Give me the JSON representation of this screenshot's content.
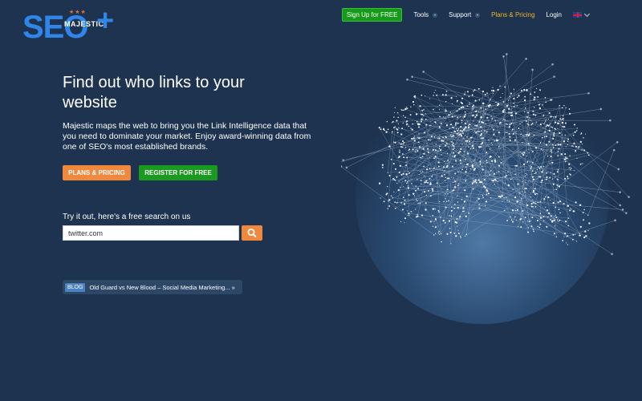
{
  "logo": {
    "text": "SEO",
    "plus": "+",
    "brand": "MAJESTIC"
  },
  "nav": {
    "signup_label": "Sign Up for FREE",
    "items": [
      {
        "label": "Tools"
      },
      {
        "label": "Support"
      }
    ],
    "plans_label": "Plans & Pricing",
    "login_label": "Login"
  },
  "hero": {
    "headline": "Find out who links to your website",
    "description": "Majestic maps the web to bring you the Link Intelligence data that you need to dominate your market. Enjoy award-winning data from one of SEO's most established brands.",
    "plans_button": "PLANS & PRICING",
    "register_button": "REGISTER FOR FREE"
  },
  "search": {
    "prompt": "Try it out, here's a free search on us",
    "value": "twitter.com"
  },
  "blog": {
    "tag": "BLOG",
    "title": "Old Guard vs New Blood – Social Media Marketing... »"
  },
  "colors": {
    "background": "#1d3350",
    "accent_orange": "#f0883e",
    "accent_green": "#1a9a1e",
    "logo_blue": "#2f86e8",
    "plans_yellow": "#f1b424"
  },
  "icons": [
    "search-icon",
    "caret-down-icon",
    "uk-flag-icon",
    "globe-network-graphic"
  ]
}
